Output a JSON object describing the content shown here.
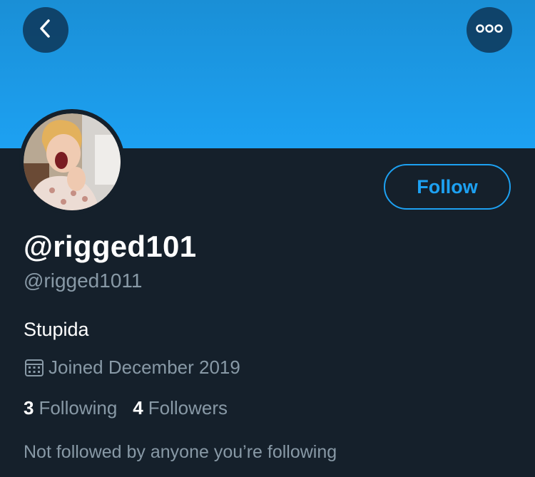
{
  "profile": {
    "display_name": "@rigged101",
    "handle": "@rigged1011",
    "bio": "Stupida",
    "joined": "Joined December 2019",
    "following_count": "3",
    "following_label": "Following",
    "followers_count": "4",
    "followers_label": "Followers",
    "mutual_note": "Not followed by anyone you’re following"
  },
  "actions": {
    "follow_label": "Follow"
  },
  "icons": {
    "back": "chevron-left-icon",
    "more": "more-horizontal-icon",
    "calendar": "calendar-icon"
  },
  "colors": {
    "background": "#15202b",
    "banner": "#1da1f2",
    "accent": "#1da1f2",
    "text_primary": "#ffffff",
    "text_secondary": "#8899a6"
  }
}
